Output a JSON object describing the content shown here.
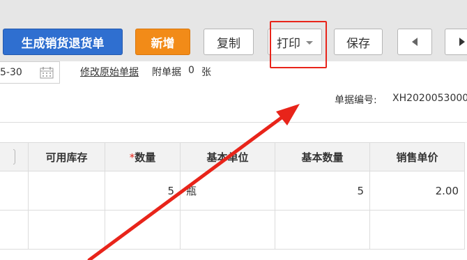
{
  "toolbar": {
    "generate_return_label": "生成销货退货单",
    "new_label": "新增",
    "copy_label": "复制",
    "print_label": "打印",
    "save_label": "保存"
  },
  "form": {
    "date_value": "5-30",
    "edit_original_link": "修改原始单据",
    "attachment_label": "附单据",
    "attachment_count": "0",
    "attachment_unit": "张",
    "doc_no_label": "单据编号:",
    "doc_no_value": "XH2020053000"
  },
  "table": {
    "columns": [
      "",
      "可用库存",
      "数量",
      "基本单位",
      "基本数量",
      "销售单价"
    ],
    "required_mark": "*",
    "rows": [
      {
        "available_stock": "",
        "quantity": "5",
        "unit": "瓶",
        "base_quantity": "5",
        "unit_price": "2.00"
      },
      {
        "available_stock": "",
        "quantity": "",
        "unit": "",
        "base_quantity": "",
        "unit_price": ""
      }
    ]
  },
  "colors": {
    "primary_blue": "#2f6fd0",
    "orange": "#f28b18",
    "annotation_red": "#e8241a",
    "toolbar_bg": "#e6e6e6"
  },
  "icons": [
    "calendar-icon",
    "dropdown-caret-icon",
    "prev-arrow-icon",
    "next-arrow-icon",
    "annotation-arrow"
  ]
}
